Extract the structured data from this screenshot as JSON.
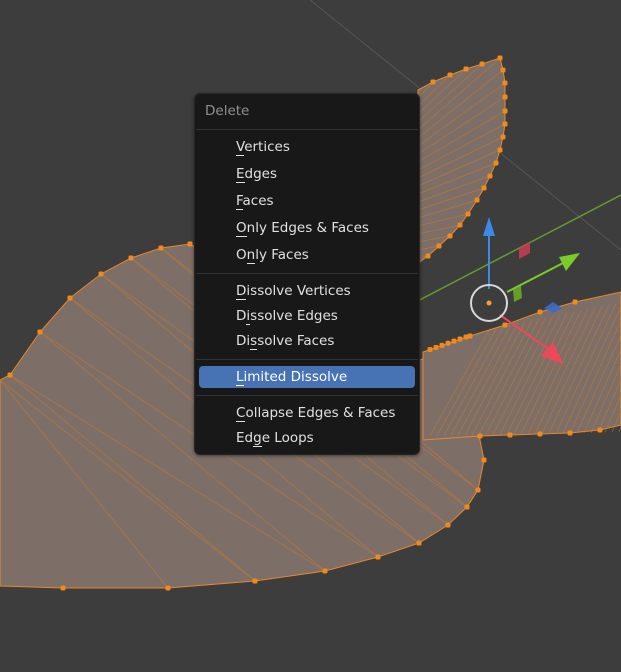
{
  "menu": {
    "title": "Delete",
    "groups": [
      [
        {
          "label": "Vertices",
          "mnemonic_index": 0
        },
        {
          "label": "Edges",
          "mnemonic_index": 0
        },
        {
          "label": "Faces",
          "mnemonic_index": 0
        },
        {
          "label": "Only Edges & Faces",
          "mnemonic_index": 0
        },
        {
          "label": "Only Faces",
          "mnemonic_index": 1
        }
      ],
      [
        {
          "label": "Dissolve Vertices",
          "mnemonic_index": 0
        },
        {
          "label": "Dissolve Edges",
          "mnemonic_index": 1
        },
        {
          "label": "Dissolve Faces",
          "mnemonic_index": 2
        }
      ],
      [
        {
          "label": "Limited Dissolve",
          "mnemonic_index": 0,
          "active": true
        }
      ],
      [
        {
          "label": "Collapse Edges & Faces",
          "mnemonic_index": 0
        },
        {
          "label": "Edge Loops",
          "mnemonic_index": 2
        }
      ]
    ]
  },
  "colors": {
    "background": "#3d3d3d",
    "mesh_face": "#7d6f67",
    "mesh_edge": "#e8872a",
    "vertex": "#f08a1c",
    "axis_x": "#f0465a",
    "axis_y": "#7bcc2a",
    "axis_z": "#3d8ae6",
    "highlight": "#4772b3"
  },
  "gizmo": {
    "type": "transform-move-gizmo"
  }
}
